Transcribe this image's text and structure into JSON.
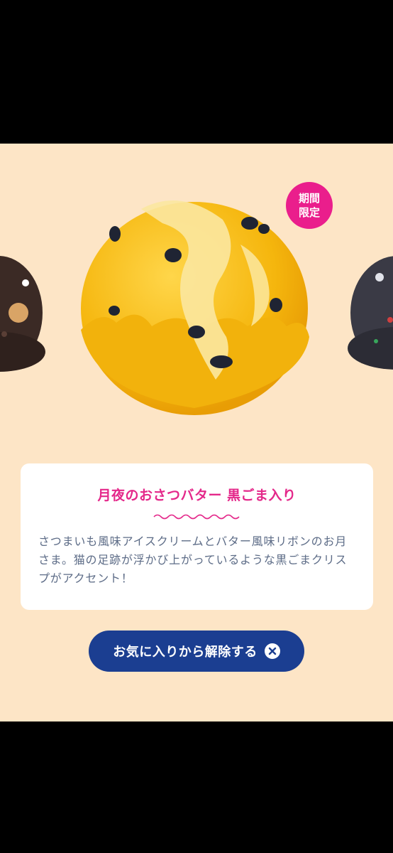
{
  "badge": {
    "line1": "期間",
    "line2": "限定"
  },
  "product": {
    "title": "月夜のおさつバター 黒ごま入り",
    "description": "さつまいも風味アイスクリームとバター風味リボンのお月さま。猫の足跡が浮かび上がっているような黒ごまクリスプがアクセント！"
  },
  "actions": {
    "remove_favorite": "お気に入りから解除する"
  },
  "colors": {
    "background": "#fde5c6",
    "badge": "#ea1e8c",
    "title": "#e4288a",
    "button": "#1b3e91",
    "description": "#5d6c87"
  },
  "icons": {
    "remove": "close-circle-icon"
  }
}
